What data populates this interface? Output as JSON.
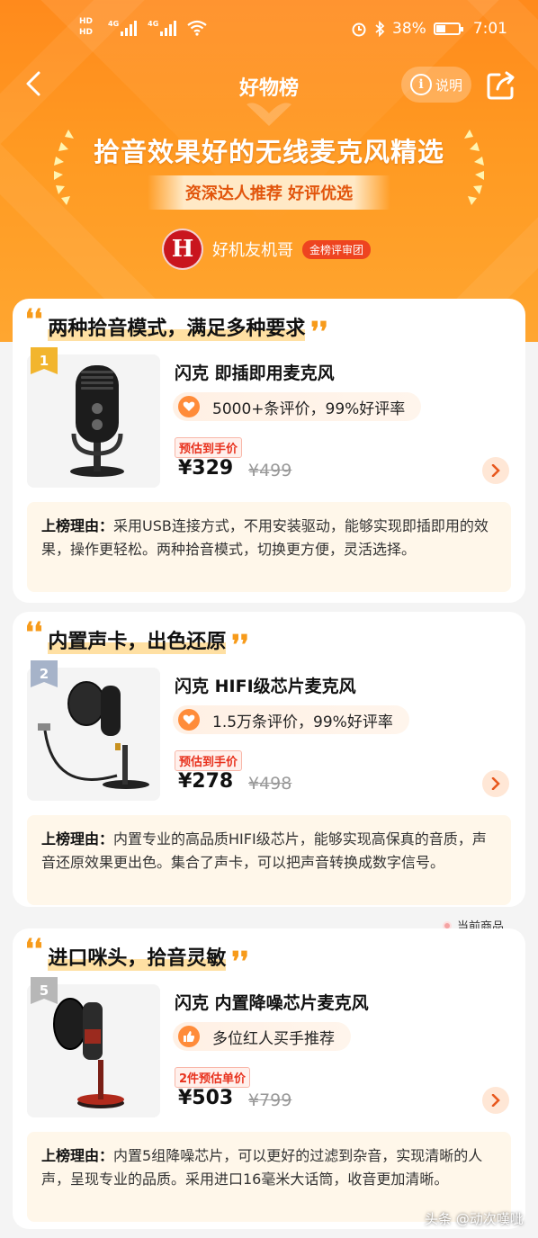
{
  "status_bar": {
    "hd1": "HD",
    "hd2": "HD",
    "net1": "4G",
    "net2": "4G",
    "battery": "38%",
    "time": "7:01"
  },
  "header": {
    "title": "好物榜",
    "explain_label": "说明",
    "list_title": "拾音效果好的无线麦克风精选",
    "subtitle": "资深达人推荐 好评优选",
    "author_name": "好机友机哥",
    "author_badge": "金榜评审团",
    "avatar_letter": "H"
  },
  "products": [
    {
      "rank": "1",
      "section_title": "两种拾音模式，满足多种要求",
      "name": "闪克 即插即用麦克风",
      "rating": "5000+条评价，99%好评率",
      "rating_icon": "heart-icon",
      "price_label": "预估到手价",
      "price": "¥329",
      "original_price": "¥499",
      "reason_label": "上榜理由：",
      "reason": "采用USB连接方式，不用安装驱动，能够实现即插即用的效果，操作更轻松。两种拾音模式，切换更方便，灵活选择。"
    },
    {
      "rank": "2",
      "section_title": "内置声卡，出色还原",
      "name": "闪克 HIFI级芯片麦克风",
      "rating": "1.5万条评价，99%好评率",
      "rating_icon": "heart-icon",
      "price_label": "预估到手价",
      "price": "¥278",
      "original_price": "¥498",
      "reason_label": "上榜理由：",
      "reason": "内置专业的高品质HIFI级芯片，能够实现高保真的音质，声音还原效果更出色。集合了声卡，可以把声音转换成数字信号。"
    },
    {
      "rank": "5",
      "section_title": "进口咪头，拾音灵敏",
      "name": "闪克 内置降噪芯片麦克风",
      "rating": "多位红人买手推荐",
      "rating_icon": "thumbs-up-icon",
      "price_label": "2件预估单价",
      "price": "¥503",
      "original_price": "¥799",
      "reason_label": "上榜理由：",
      "reason": "内置5组降噪芯片，可以更好的过滤到杂音，实现清晰的人声，呈现专业的品质。采用进口16毫米大话筒，收音更加清晰。"
    }
  ],
  "current_item_label": "当前商品",
  "watermark": "头条 @动次嘆呲",
  "colors": {
    "accent": "#ff8a1c",
    "price_red": "#e8321e",
    "quote_orange": "#f79b1b"
  }
}
